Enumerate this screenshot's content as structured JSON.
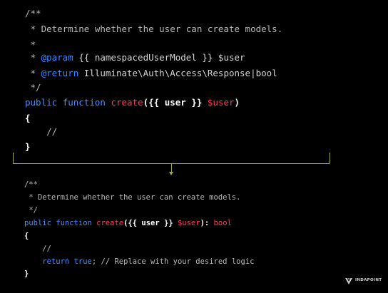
{
  "top_code": {
    "l1": "/**",
    "l2": " * Determine whether the user can create models.",
    "l3": " *",
    "l4_star": " * ",
    "l4_tag": "@param",
    "l4_rest": " {{ namespacedUserModel }} $user",
    "l5_star": " * ",
    "l5_tag": "@return",
    "l5_rest": " Illuminate\\Auth\\Access\\Response|bool",
    "l6": " */",
    "l7_public": "public",
    "l7_function": "function",
    "l7_name": "create",
    "l7_open": "({{ user }} ",
    "l7_var": "$user",
    "l7_close": ")",
    "l8": "{",
    "l9": "    //",
    "l10": "}"
  },
  "bottom_code": {
    "l1": "/**",
    "l2": " * Determine whether the user can create models.",
    "l3": " */",
    "l4_public": "public",
    "l4_function": "function",
    "l4_name": "create",
    "l4_open": "({{ user }} ",
    "l4_var": "$user",
    "l4_close": "): ",
    "l4_type": "bool",
    "l5": "{",
    "l6": "    //",
    "l7_indent": "    ",
    "l7_return": "return",
    "l7_true": "true",
    "l7_rest": "; // Replace with your desired logic",
    "l8": "}"
  },
  "logo": {
    "name": "INDAPOINT"
  },
  "colors": {
    "background": "#000000",
    "comment": "#b8b8b8",
    "keyword": "#4a8cff",
    "function_name": "#ff3b55",
    "bracket": "#9aa65a"
  }
}
